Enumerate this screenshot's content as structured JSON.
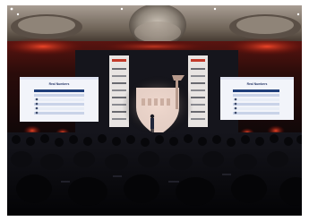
{
  "photo": {
    "description_alt": "Conference stage photo",
    "left_screen": {
      "title": "Real Numbers"
    },
    "right_screen": {
      "title": "Real Numbers"
    },
    "colors": {
      "ceiling": "#6f6458",
      "red_glow": "#c2281a",
      "stage_backdrop": "#15151c",
      "screen": "#f2f4fa",
      "screen_header": "#dfe4f2",
      "banner": "#e8e4e2",
      "shield": "#f0d9cf",
      "audience": "#07070a"
    }
  }
}
